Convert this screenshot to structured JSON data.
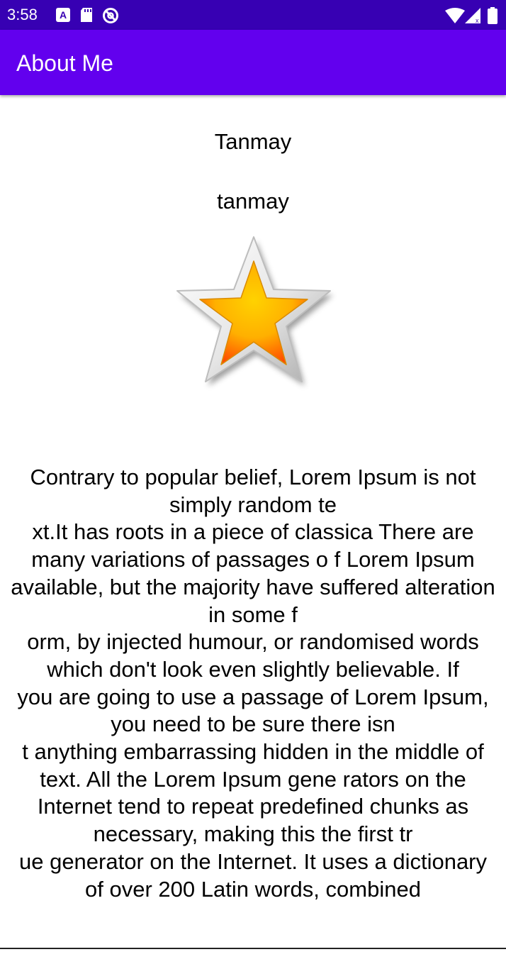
{
  "status_bar": {
    "time": "3:58",
    "left_icons": [
      "accessibility-a-icon",
      "sd-card-icon",
      "do-not-disturb-icon"
    ],
    "right_icons": [
      "wifi-icon",
      "cellular-signal-icon",
      "battery-icon"
    ]
  },
  "app_bar": {
    "title": "About Me",
    "color": "#6200EE",
    "status_color": "#3700B3"
  },
  "profile": {
    "name": "Tanmay",
    "nickname": "tanmay",
    "image_icon": "star-icon"
  },
  "description": "Contrary to popular belief, Lorem Ipsum is not simply random te\nxt.It has roots in a piece of classica There are many variations of passages o f Lorem Ipsum available, but the majority have suffered alteration in some f\norm, by injected humour, or randomised words which don't look even slightly believable. If\nyou are going to use a passage of Lorem Ipsum, you need to be sure there isn\nt anything embarrassing hidden in the middle of text. All the Lorem Ipsum gene rators on the Internet tend to repeat predefined chunks as necessary, making this the first tr\nue generator on the Internet. It uses a dictionary of over 200 Latin words, combined"
}
